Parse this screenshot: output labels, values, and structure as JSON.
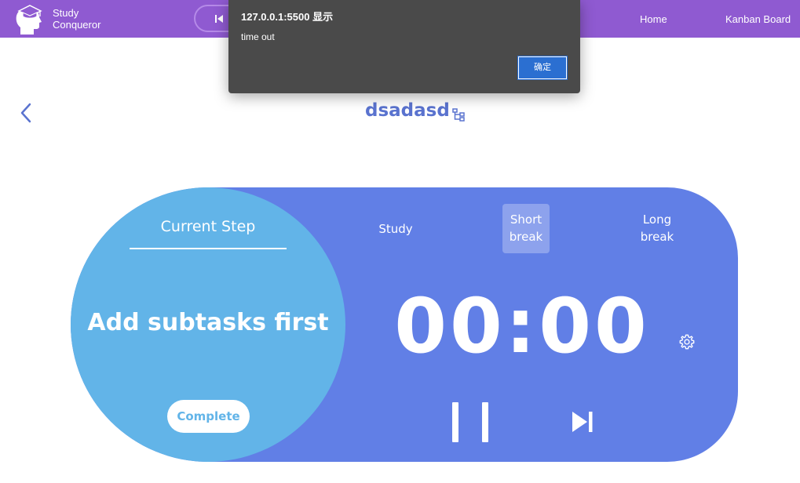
{
  "app": {
    "brand_line1": "Study",
    "brand_line2": "Conqueror",
    "logo_icon": "head-graduation-cap-icon"
  },
  "nav": {
    "home": "Home",
    "kanban": "Kanban Board",
    "player_prev_icon": "skip-previous-icon"
  },
  "alert": {
    "title": "127.0.0.1:5500 显示",
    "message": "time out",
    "ok_label": "确定"
  },
  "header": {
    "back_icon": "chevron-left-icon",
    "task_title": "dsadasd",
    "tree_icon": "hierarchy-tree-icon"
  },
  "pomodoro": {
    "step_label": "Current Step",
    "step_text": "Add subtasks first",
    "complete_label": "Complete",
    "modes": {
      "study": "Study",
      "short_break_line1": "Short",
      "short_break_line2": "break",
      "long_break_line1": "Long",
      "long_break_line2": "break"
    },
    "active_mode": "short_break",
    "timer": "00:00",
    "settings_icon": "gear-icon",
    "pause_icon": "pause-icon",
    "skip_icon": "skip-next-icon"
  },
  "colors": {
    "nav_bg": "#8f5ad1",
    "card_bg": "#617fe6",
    "circle_bg": "#62b4e8",
    "title_color": "#5a73cf",
    "alert_bg": "#4a4a4a",
    "alert_button": "#2b6fd1"
  }
}
